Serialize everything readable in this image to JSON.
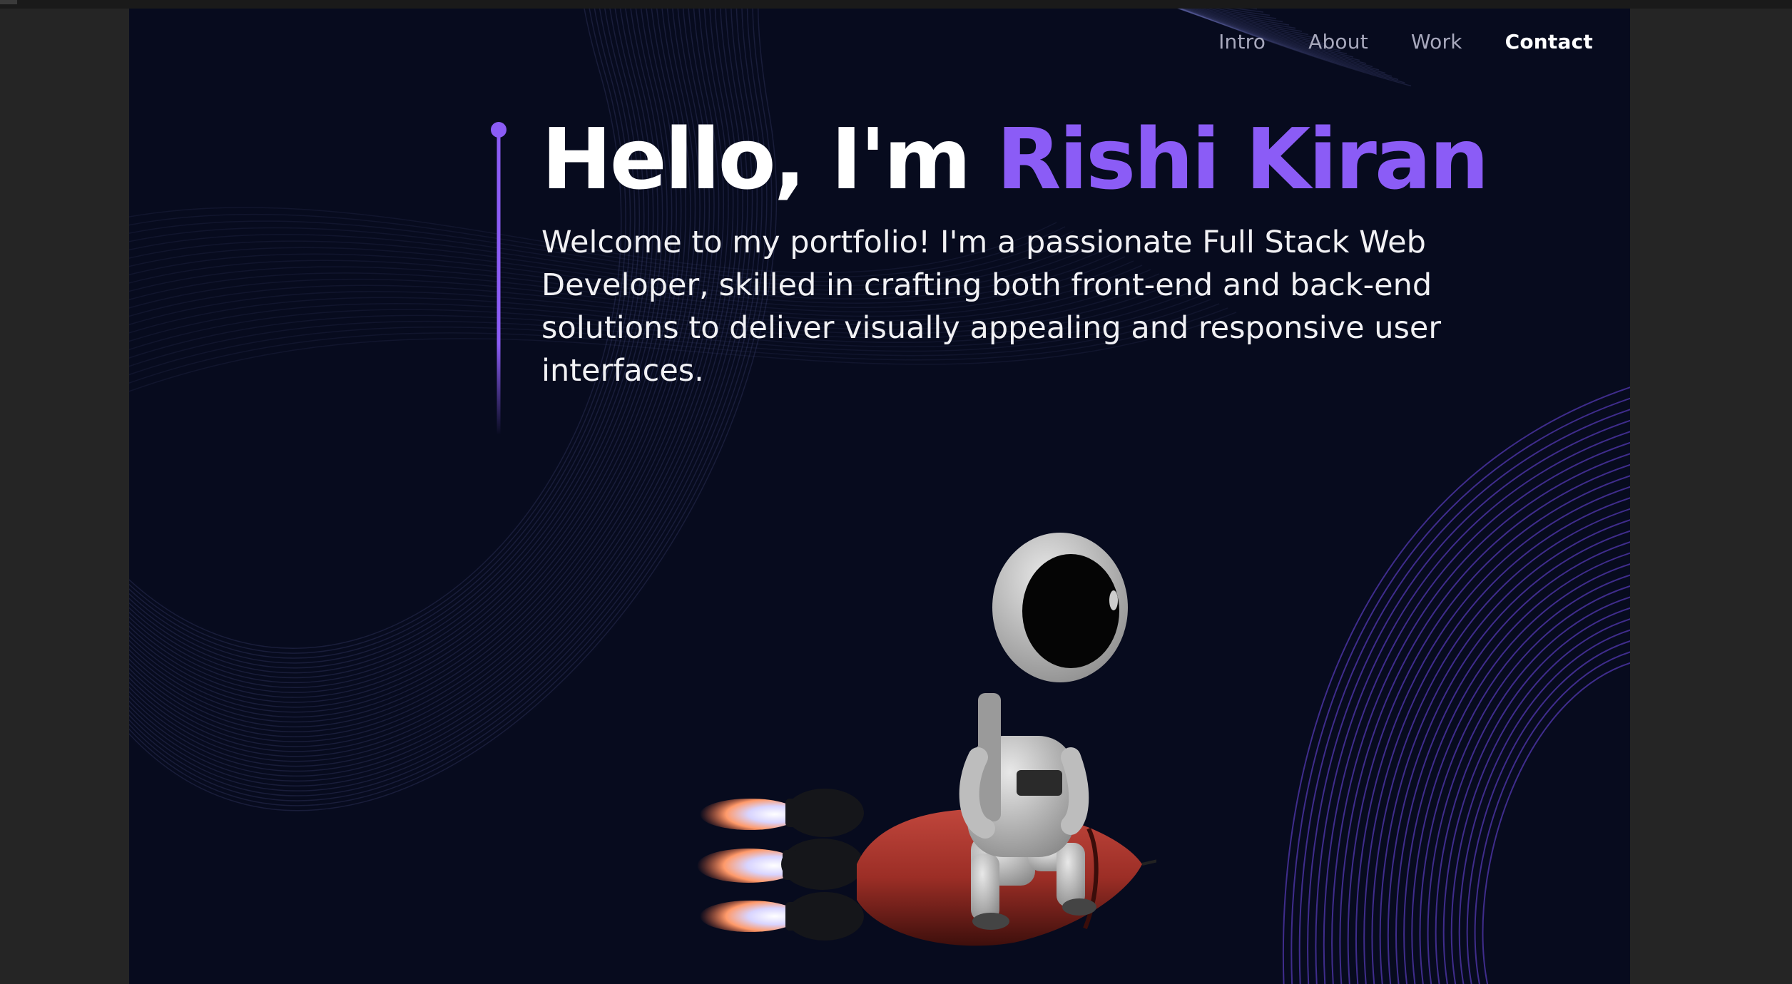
{
  "nav": {
    "items": [
      {
        "label": "Intro"
      },
      {
        "label": "About"
      },
      {
        "label": "Work"
      },
      {
        "label": "Contact"
      }
    ],
    "active": "Contact"
  },
  "hero": {
    "greeting": "Hello, I'm",
    "name": "Rishi Kiran",
    "intro": "Welcome to my portfolio! I'm a passionate Full Stack Web Developer, skilled in crafting both front-end and back-end solutions to deliver visually appealing and responsive user interfaces."
  },
  "colors": {
    "background": "#070b1e",
    "accent": "#8b5cf6",
    "nav_inactive": "#a8a9bd",
    "text": "#ffffff"
  },
  "icons": {
    "illustration": "astronaut-on-rocket",
    "decor": "wave-lines"
  }
}
